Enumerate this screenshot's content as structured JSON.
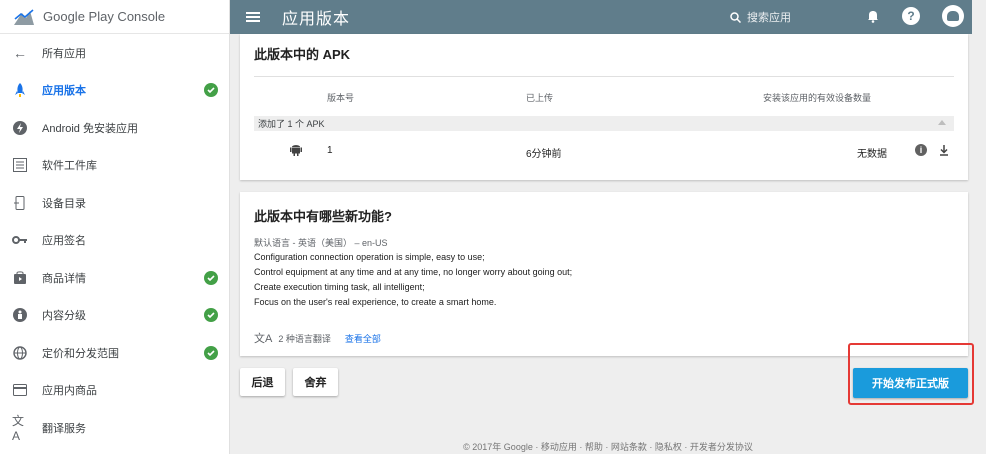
{
  "brand": {
    "name": "Google Play Console"
  },
  "topbar": {
    "title": "应用版本",
    "search_placeholder": "搜索应用"
  },
  "sidebar": {
    "items": [
      {
        "label": "所有应用",
        "icon": "arrow-back-icon",
        "active": false,
        "check": false
      },
      {
        "label": "应用版本",
        "icon": "rocket-icon",
        "active": true,
        "check": true
      },
      {
        "label": "Android 免安装应用",
        "icon": "bolt-icon",
        "active": false,
        "check": false
      },
      {
        "label": "软件工件库",
        "icon": "library-icon",
        "active": false,
        "check": false
      },
      {
        "label": "设备目录",
        "icon": "device-icon",
        "active": false,
        "check": false
      },
      {
        "label": "应用签名",
        "icon": "key-icon",
        "active": false,
        "check": false
      },
      {
        "label": "商品详情",
        "icon": "store-icon",
        "active": false,
        "check": true
      },
      {
        "label": "内容分级",
        "icon": "rating-icon",
        "active": false,
        "check": true
      },
      {
        "label": "定价和分发范围",
        "icon": "globe-icon",
        "active": false,
        "check": true
      },
      {
        "label": "应用内商品",
        "icon": "card-icon",
        "active": false,
        "check": false
      },
      {
        "label": "翻译服务",
        "icon": "translate-icon",
        "active": false,
        "check": false
      }
    ]
  },
  "apk_card": {
    "title": "此版本中的 APK",
    "columns": [
      "版本号",
      "已上传",
      "安装该应用的有效设备数量"
    ],
    "group_label": "添加了 1 个 APK",
    "row": {
      "version": "1",
      "uploaded": "6分钟前",
      "devices": "无数据"
    }
  },
  "whats_new": {
    "title": "此版本中有哪些新功能?",
    "language": "默认语言 - 英语（美国） – en-US",
    "notes": [
      "Configuration connection operation is simple, easy to use;",
      "Control equipment at any time and at any time, no longer worry about going out;",
      "Create execution timing task, all intelligent;",
      "Focus on the user's real experience, to create a smart home."
    ],
    "translations": "2 种语言翻译",
    "view_all": "查看全部"
  },
  "actions": {
    "back": "后退",
    "discard": "舍弃",
    "rollout": "开始发布正式版"
  },
  "footer": "© 2017年 Google · 移动应用 · 帮助 · 网站条款 · 隐私权 · 开发者分发协议",
  "colors": {
    "topbar": "#607d8b",
    "accent": "#1a73e8",
    "primary_button": "#1a9bdc",
    "check": "#43a047",
    "highlight": "#e53935"
  }
}
